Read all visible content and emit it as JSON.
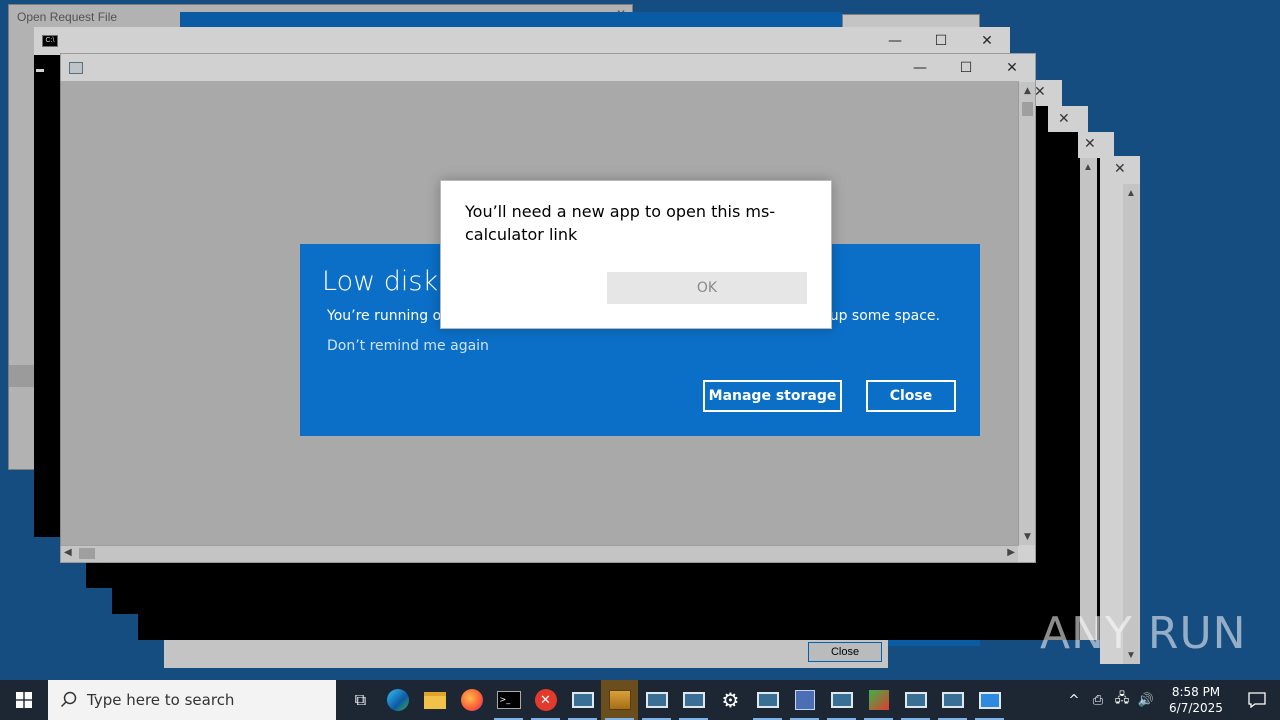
{
  "background_windows": {
    "open_request_file_title": "Open Request File",
    "bottom_close_label": "Close"
  },
  "caption": {
    "minimize": "—",
    "maximize": "☐",
    "close": "✕"
  },
  "toast": {
    "title": "Low disk s",
    "body_left": "You’re running ou",
    "body_right": "e up some space.",
    "dont_remind": "Don’t remind me again",
    "manage_storage": "Manage storage",
    "close": "Close",
    "accent_color": "#0b6fc8"
  },
  "dialog": {
    "message": "You’ll need a new app to open this ms-calculator link",
    "ok": "OK"
  },
  "taskbar": {
    "search_placeholder": "Type here to search",
    "apps": [
      "task-view",
      "edge",
      "file-explorer",
      "firefox",
      "cmd",
      "error-app",
      "window-app",
      "archive-app",
      "window-app",
      "window-app",
      "settings",
      "window-app",
      "setup-app",
      "window-app",
      "tool-app",
      "window-app",
      "window-app",
      "monitor-app"
    ],
    "clock_time": "8:58 PM",
    "clock_date": "6/7/2025"
  },
  "watermark": "ANY RUN"
}
